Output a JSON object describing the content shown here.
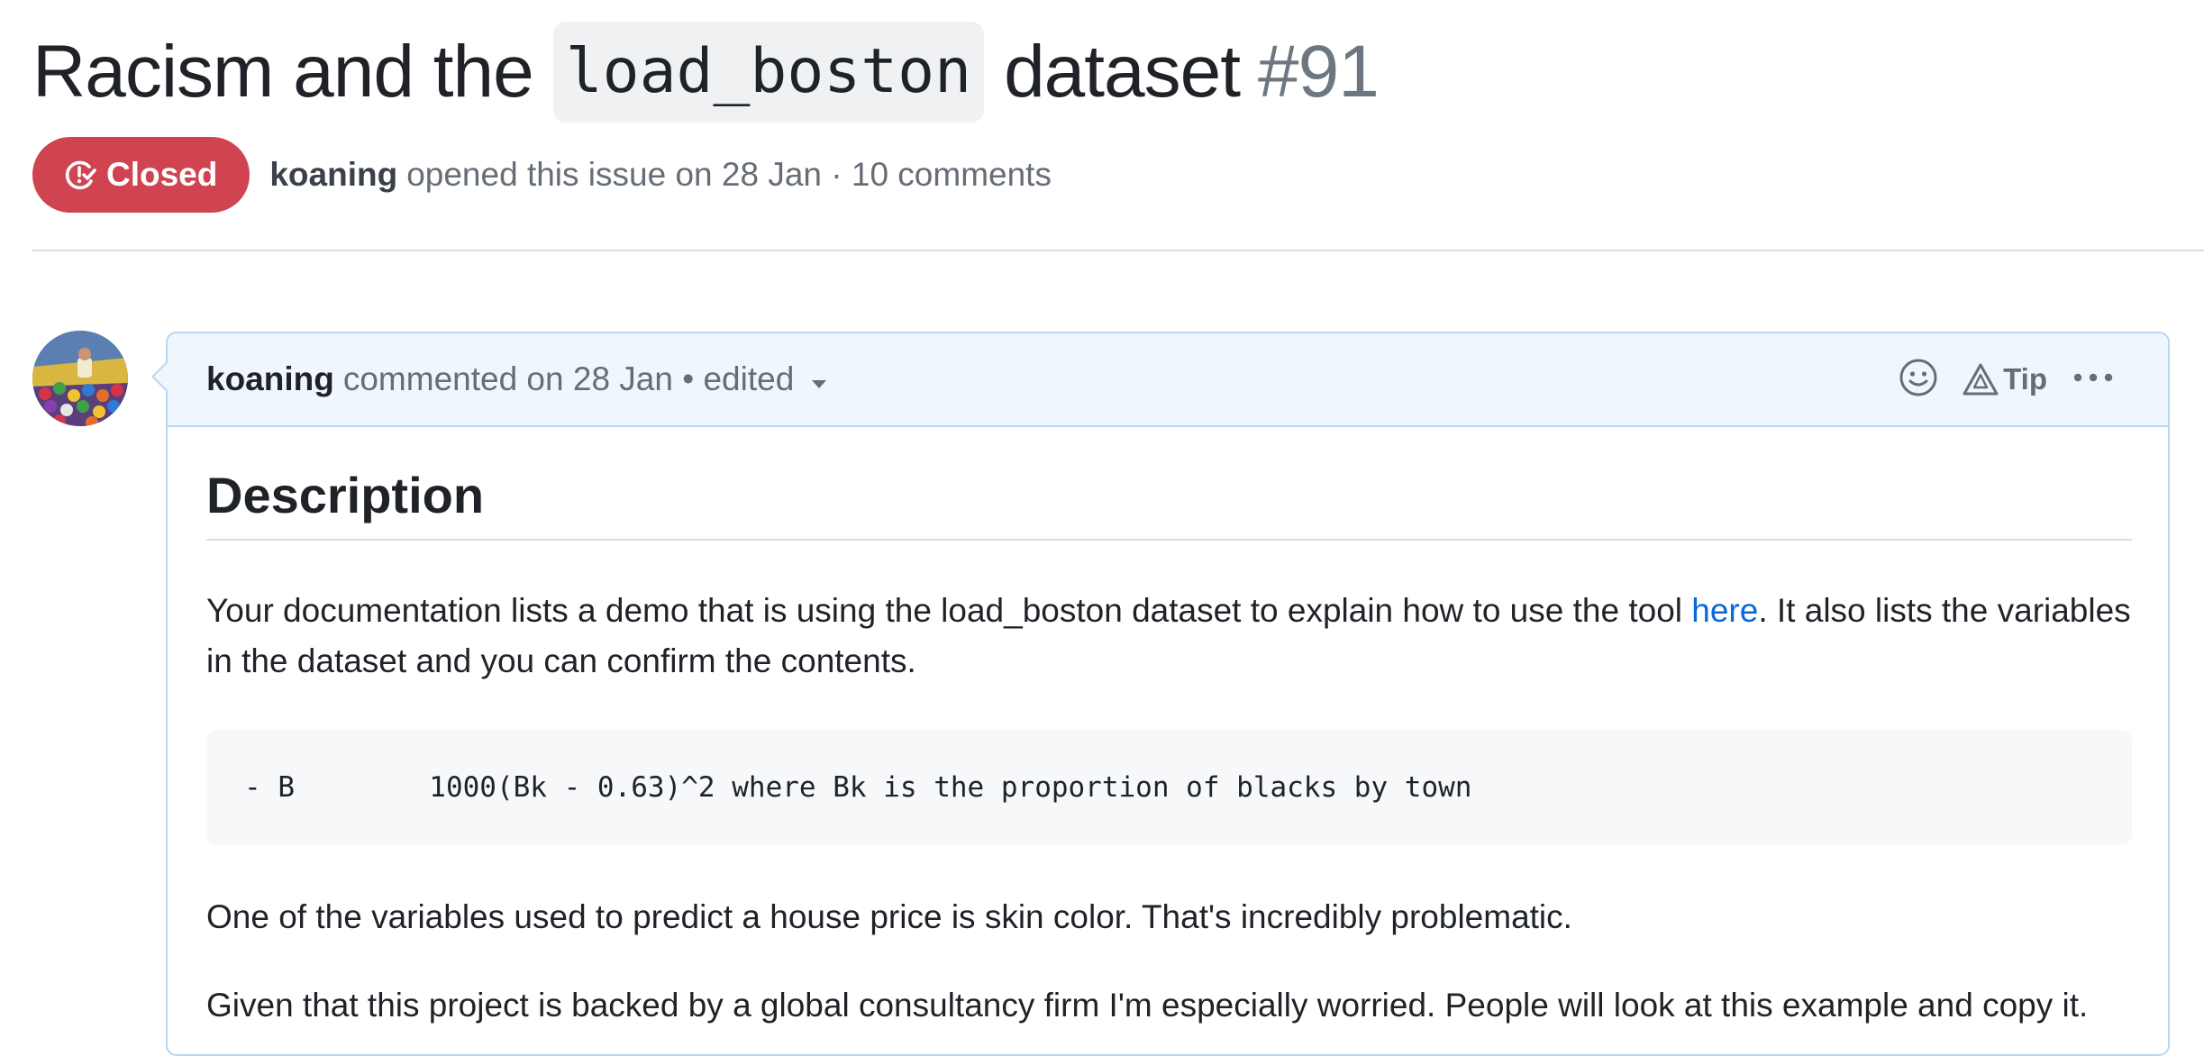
{
  "issue": {
    "title_prefix": "Racism and the",
    "title_code": "load_boston",
    "title_suffix": "dataset",
    "number": "#91",
    "status": "Closed",
    "status_color": "#cf4450",
    "author": "koaning",
    "meta": "opened this issue on 28 Jan · 10 comments"
  },
  "comment": {
    "author": "koaning",
    "meta": "commented on 28 Jan • edited",
    "tip_label": "Tip",
    "icons": [
      "smiley-icon",
      "alert-triangle-icon",
      "kebab-icon",
      "chevron-down-icon"
    ],
    "heading": "Description",
    "p1_before_link": "Your documentation lists a demo that is using the load_boston dataset to explain how to use the tool ",
    "p1_link": "here",
    "p1_after_link": ". It also lists the variables in the dataset and you can confirm the contents.",
    "code": "- B        1000(Bk - 0.63)^2 where Bk is the proportion of blacks by town",
    "p2": "One of the variables used to predict a house price is skin color. That's incredibly problematic.",
    "p3": "Given that this project is backed by a global consultancy firm I'm especially worried. People will look at this example and copy it."
  },
  "colors": {
    "link": "#0969da",
    "header_bg": "#f0f6fd",
    "border": "#b6d7f3"
  }
}
